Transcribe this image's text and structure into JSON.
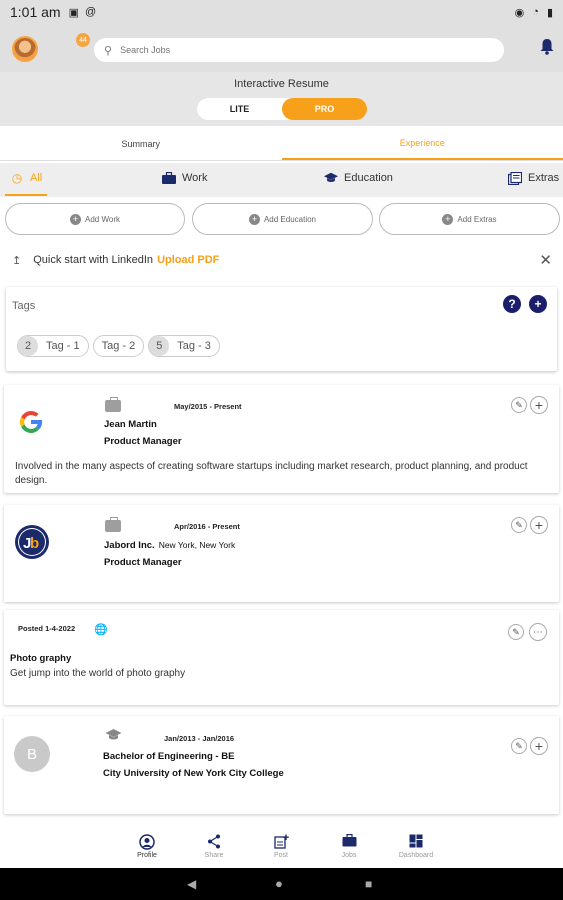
{
  "status": {
    "time": "1:01 am",
    "left_icons": [
      "save-icon",
      "at-icon"
    ],
    "right_icons": [
      "eye-icon",
      "wifi-icon",
      "battery-icon"
    ]
  },
  "header": {
    "badge": "44",
    "search_placeholder": "Search Jobs"
  },
  "resume": {
    "title": "Interactive Resume",
    "options": [
      "LITE",
      "PRO"
    ],
    "active": "PRO"
  },
  "tabs": [
    {
      "label": "Summary",
      "active": false
    },
    {
      "label": "Experience",
      "active": true
    }
  ],
  "categories": [
    {
      "label": "All",
      "icon": "clock-icon",
      "active": true
    },
    {
      "label": "Work",
      "icon": "briefcase-icon",
      "active": false
    },
    {
      "label": "Education",
      "icon": "graduation-cap-icon",
      "active": false
    },
    {
      "label": "Extras",
      "icon": "extras-icon",
      "active": false
    }
  ],
  "add_buttons": [
    "Add Work",
    "Add Education",
    "Add Extras"
  ],
  "linkedin": {
    "text": "Quick start with LinkedIn",
    "link": "Upload PDF"
  },
  "tags": {
    "label": "Tags",
    "chips": [
      {
        "count": "2",
        "label": "Tag - 1"
      },
      {
        "count": "",
        "label": "Tag - 2"
      },
      {
        "count": "5",
        "label": "Tag - 3"
      }
    ]
  },
  "entries": [
    {
      "type": "work",
      "logo": "google-logo",
      "date": "May/2015 - Present",
      "name": "Jean Martin",
      "location": "",
      "role": "Product Manager",
      "description": "Involved in the many aspects of creating software startups including market research, product planning, and product design."
    },
    {
      "type": "work",
      "logo": "jabord-logo",
      "date": "Apr/2016 - Present",
      "name": "Jabord Inc.",
      "location": "New York, New York",
      "role": "Product Manager",
      "description": ""
    },
    {
      "type": "post",
      "posted": "Posted 1-4-2022",
      "title": "Photo graphy",
      "description": "Get jump into the world of photo graphy"
    },
    {
      "type": "education",
      "logo_letter": "B",
      "date": "Jan/2013 - Jan/2016",
      "name": "Bachelor of Engineering - BE",
      "institution": "City University of New York City College"
    }
  ],
  "bottom_nav": [
    {
      "label": "Profile",
      "icon": "profile-icon",
      "active": true
    },
    {
      "label": "Share",
      "icon": "share-icon",
      "active": false
    },
    {
      "label": "Post",
      "icon": "post-icon",
      "active": false
    },
    {
      "label": "Jobs",
      "icon": "jobs-icon",
      "active": false
    },
    {
      "label": "Dashboard",
      "icon": "dashboard-icon",
      "active": false
    }
  ],
  "colors": {
    "accent": "#f7a11a",
    "navy": "#1b2a6b",
    "bar": "#e0e0e0"
  }
}
